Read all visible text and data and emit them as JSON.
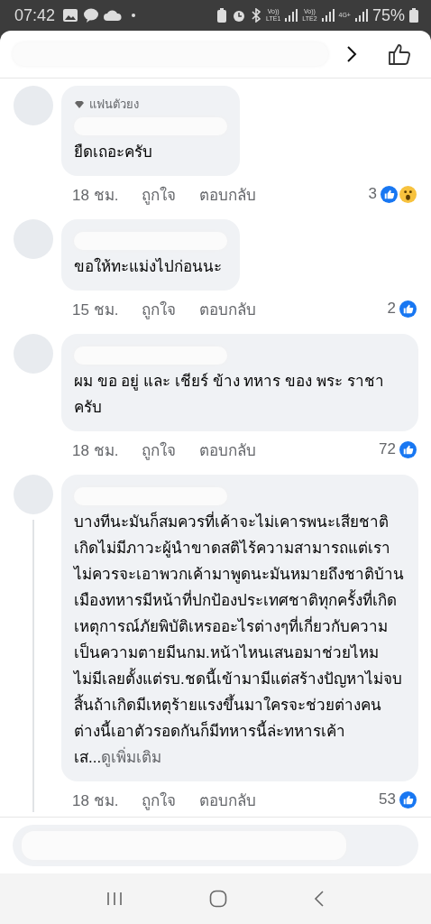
{
  "status_bar": {
    "time": "07:42",
    "indicators": [
      {
        "label": "Vo))",
        "sub": "LTE1"
      },
      {
        "label": "Vo))",
        "sub": "LTE2"
      },
      {
        "label": "4G+"
      }
    ],
    "battery": "75%"
  },
  "comments": [
    {
      "badge": "แฟนตัวยง",
      "text": "ยืดเถอะครับ",
      "time": "18 ชม.",
      "like_label": "ถูกใจ",
      "reply_label": "ตอบกลับ",
      "reaction_count": "3",
      "reactions": [
        {
          "kind": "like"
        },
        {
          "kind": "wow"
        }
      ],
      "thread": false
    },
    {
      "text": "ขอให้ทะแม่งไปก่อนนะ",
      "time": "15 ชม.",
      "like_label": "ถูกใจ",
      "reply_label": "ตอบกลับ",
      "reaction_count": "2",
      "reactions": [
        {
          "kind": "like"
        }
      ],
      "thread": false
    },
    {
      "text": "ผม ขอ อยู่ และ เชียร์ ข้าง ทหาร ของ พระ ราชา ครับ",
      "time": "18 ชม.",
      "like_label": "ถูกใจ",
      "reply_label": "ตอบกลับ",
      "reaction_count": "72",
      "reactions": [
        {
          "kind": "like"
        }
      ],
      "thread": false
    },
    {
      "text": "บางทีนะมันก็สมควรที่เค้าจะไม่เคารพนะเสียชาติเกิดไม่มีภาวะผู้นำขาดสติไร้ความสามารถแต่เราไม่ควรจะเอาพวกเค้ามาพูดนะมันหมายถึงชาติบ้านเมืองทหารมีหน้าที่ปกป้องประเทศชาติทุกครั้งที่เกิดเหตุการณ์ภัยพิบัติเหรออะไรต่างๆที่เกี่ยวกับความเป็นความตายมีนกม.หน้าไหนเสนอมาช่วยไหมไม่มีเลยตั้งแต่รบ.ชดนี้เข้ามามีแต่สร้างปัญหาไม่จบสิ้นถ้าเกิดมีเหตุร้ายแรงขึ้นมาใครจะช่วยต่างคนต่างนี้เอาตัวรอดกันก็มีทหารนี้ล่ะทหารเค้าเส...",
      "see_more": "ดูเพิ่มเติม",
      "time": "18 ชม.",
      "like_label": "ถูกใจ",
      "reply_label": "ตอบกลับ",
      "reaction_count": "53",
      "reactions": [
        {
          "kind": "like"
        }
      ],
      "thread": true
    }
  ]
}
